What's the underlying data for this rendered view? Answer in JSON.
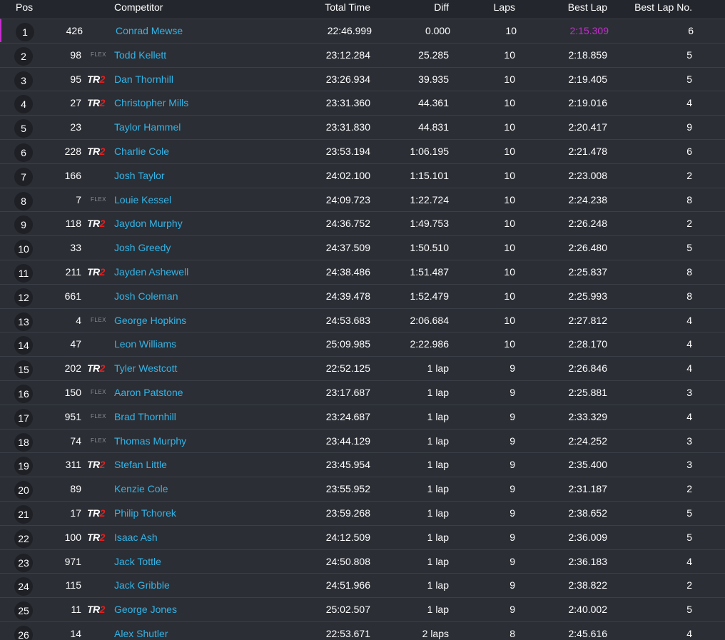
{
  "header": {
    "pos": "Pos",
    "competitor": "Competitor",
    "total_time": "Total Time",
    "diff": "Diff",
    "laps": "Laps",
    "best_lap": "Best Lap",
    "best_lap_no": "Best Lap No."
  },
  "colors": {
    "background": "#2b2e35",
    "header_background": "#23262c",
    "competitor_link": "#35b4e6",
    "fastest_lap": "#c62dd0",
    "tr2_accent": "#e02020"
  },
  "rows": [
    {
      "pos": "1",
      "number": "426",
      "badge": "",
      "name": "Conrad Mewse",
      "total": "22:46.999",
      "diff": "0.000",
      "laps": "10",
      "best": "2:15.309",
      "best_no": "6",
      "fastest": true
    },
    {
      "pos": "2",
      "number": "98",
      "badge": "FLEX",
      "name": "Todd Kellett",
      "total": "23:12.284",
      "diff": "25.285",
      "laps": "10",
      "best": "2:18.859",
      "best_no": "5"
    },
    {
      "pos": "3",
      "number": "95",
      "badge": "TR2",
      "name": "Dan Thornhill",
      "total": "23:26.934",
      "diff": "39.935",
      "laps": "10",
      "best": "2:19.405",
      "best_no": "5"
    },
    {
      "pos": "4",
      "number": "27",
      "badge": "TR2",
      "name": "Christopher Mills",
      "total": "23:31.360",
      "diff": "44.361",
      "laps": "10",
      "best": "2:19.016",
      "best_no": "4"
    },
    {
      "pos": "5",
      "number": "23",
      "badge": "",
      "name": "Taylor Hammel",
      "total": "23:31.830",
      "diff": "44.831",
      "laps": "10",
      "best": "2:20.417",
      "best_no": "9"
    },
    {
      "pos": "6",
      "number": "228",
      "badge": "TR2",
      "name": "Charlie Cole",
      "total": "23:53.194",
      "diff": "1:06.195",
      "laps": "10",
      "best": "2:21.478",
      "best_no": "6"
    },
    {
      "pos": "7",
      "number": "166",
      "badge": "",
      "name": "Josh Taylor",
      "total": "24:02.100",
      "diff": "1:15.101",
      "laps": "10",
      "best": "2:23.008",
      "best_no": "2"
    },
    {
      "pos": "8",
      "number": "7",
      "badge": "FLEX",
      "name": "Louie Kessel",
      "total": "24:09.723",
      "diff": "1:22.724",
      "laps": "10",
      "best": "2:24.238",
      "best_no": "8"
    },
    {
      "pos": "9",
      "number": "118",
      "badge": "TR2",
      "name": "Jaydon Murphy",
      "total": "24:36.752",
      "diff": "1:49.753",
      "laps": "10",
      "best": "2:26.248",
      "best_no": "2"
    },
    {
      "pos": "10",
      "number": "33",
      "badge": "",
      "name": "Josh Greedy",
      "total": "24:37.509",
      "diff": "1:50.510",
      "laps": "10",
      "best": "2:26.480",
      "best_no": "5"
    },
    {
      "pos": "11",
      "number": "211",
      "badge": "TR2",
      "name": "Jayden Ashewell",
      "total": "24:38.486",
      "diff": "1:51.487",
      "laps": "10",
      "best": "2:25.837",
      "best_no": "8"
    },
    {
      "pos": "12",
      "number": "661",
      "badge": "",
      "name": "Josh Coleman",
      "total": "24:39.478",
      "diff": "1:52.479",
      "laps": "10",
      "best": "2:25.993",
      "best_no": "8"
    },
    {
      "pos": "13",
      "number": "4",
      "badge": "FLEX",
      "name": "George Hopkins",
      "total": "24:53.683",
      "diff": "2:06.684",
      "laps": "10",
      "best": "2:27.812",
      "best_no": "4"
    },
    {
      "pos": "14",
      "number": "47",
      "badge": "",
      "name": "Leon Williams",
      "total": "25:09.985",
      "diff": "2:22.986",
      "laps": "10",
      "best": "2:28.170",
      "best_no": "4"
    },
    {
      "pos": "15",
      "number": "202",
      "badge": "TR2",
      "name": "Tyler Westcott",
      "total": "22:52.125",
      "diff": "1 lap",
      "laps": "9",
      "best": "2:26.846",
      "best_no": "4"
    },
    {
      "pos": "16",
      "number": "150",
      "badge": "FLEX",
      "name": "Aaron Patstone",
      "total": "23:17.687",
      "diff": "1 lap",
      "laps": "9",
      "best": "2:25.881",
      "best_no": "3"
    },
    {
      "pos": "17",
      "number": "951",
      "badge": "FLEX",
      "name": "Brad Thornhill",
      "total": "23:24.687",
      "diff": "1 lap",
      "laps": "9",
      "best": "2:33.329",
      "best_no": "4"
    },
    {
      "pos": "18",
      "number": "74",
      "badge": "FLEX",
      "name": "Thomas Murphy",
      "total": "23:44.129",
      "diff": "1 lap",
      "laps": "9",
      "best": "2:24.252",
      "best_no": "3"
    },
    {
      "pos": "19",
      "number": "311",
      "badge": "TR2",
      "name": "Stefan Little",
      "total": "23:45.954",
      "diff": "1 lap",
      "laps": "9",
      "best": "2:35.400",
      "best_no": "3"
    },
    {
      "pos": "20",
      "number": "89",
      "badge": "",
      "name": "Kenzie Cole",
      "total": "23:55.952",
      "diff": "1 lap",
      "laps": "9",
      "best": "2:31.187",
      "best_no": "2"
    },
    {
      "pos": "21",
      "number": "17",
      "badge": "TR2",
      "name": "Philip Tchorek",
      "total": "23:59.268",
      "diff": "1 lap",
      "laps": "9",
      "best": "2:38.652",
      "best_no": "5"
    },
    {
      "pos": "22",
      "number": "100",
      "badge": "TR2",
      "name": "Isaac Ash",
      "total": "24:12.509",
      "diff": "1 lap",
      "laps": "9",
      "best": "2:36.009",
      "best_no": "5"
    },
    {
      "pos": "23",
      "number": "971",
      "badge": "",
      "name": "Jack Tottle",
      "total": "24:50.808",
      "diff": "1 lap",
      "laps": "9",
      "best": "2:36.183",
      "best_no": "4"
    },
    {
      "pos": "24",
      "number": "115",
      "badge": "",
      "name": "Jack Gribble",
      "total": "24:51.966",
      "diff": "1 lap",
      "laps": "9",
      "best": "2:38.822",
      "best_no": "2"
    },
    {
      "pos": "25",
      "number": "11",
      "badge": "TR2",
      "name": "George Jones",
      "total": "25:02.507",
      "diff": "1 lap",
      "laps": "9",
      "best": "2:40.002",
      "best_no": "5"
    },
    {
      "pos": "26",
      "number": "14",
      "badge": "",
      "name": "Alex Shutler",
      "total": "22:53.671",
      "diff": "2 laps",
      "laps": "8",
      "best": "2:45.616",
      "best_no": "4"
    }
  ]
}
